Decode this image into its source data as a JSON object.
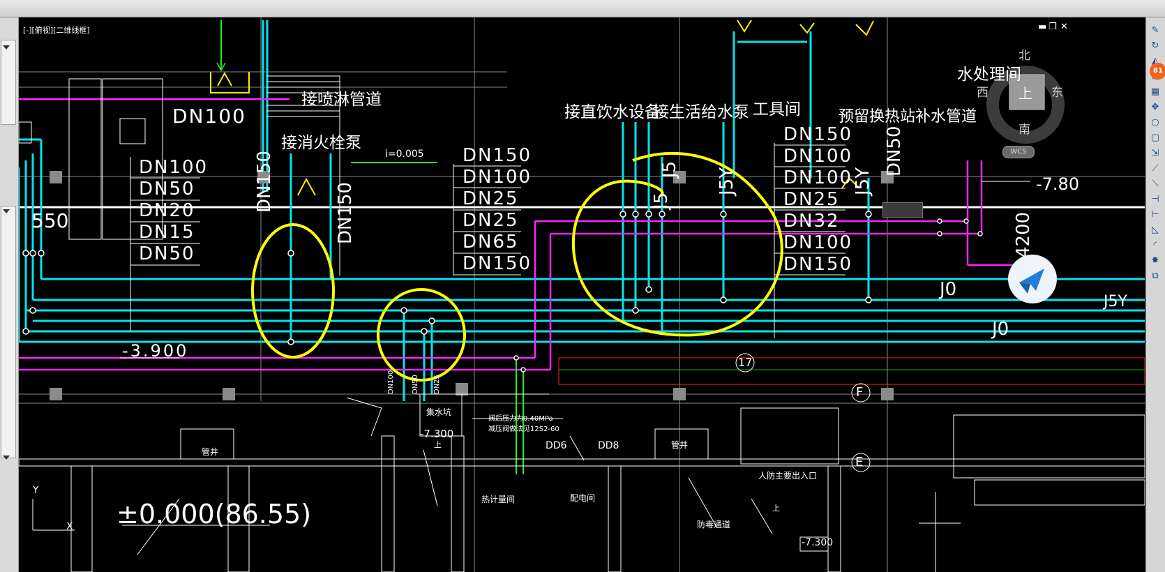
{
  "window": {
    "view_label": "[-][俯视][二维线框]",
    "min_icon": "minimize-icon",
    "restore_icon": "restore-icon",
    "close_icon": "close-icon"
  },
  "viewcube": {
    "north": "北",
    "south": "南",
    "east": "东",
    "west": "西",
    "top": "上",
    "wcs": "WCS"
  },
  "badge": "81",
  "labels": {
    "spray": "接喷淋管道",
    "hydrant": "接消火栓泵",
    "drinking": "接直饮水设备",
    "domestic": "接生活给水泵",
    "tool_room": "工具间",
    "water_room": "水处理间",
    "heat_station": "预留换热站补水管道",
    "slope": "i=0.005",
    "elev_neg39": "-3.900",
    "elev_pos0": "±0.000(86.55)",
    "elev_neg73": "-7.300",
    "elev_neg73b": "-7.300",
    "elev_780": "-7.80",
    "num_4200": "4200",
    "sump": "集水坑",
    "valve1": "阀后压力为0.40MPa",
    "valve2": "减压阀做法见12S2-60",
    "shaft1": "管井",
    "shaft2": "管井",
    "heat_meter": "热计量间",
    "dist_room": "配电间",
    "civil_entry": "人防主要出入口",
    "gas_pass": "防毒通道",
    "dd6": "DD6",
    "dd8": "DD8",
    "axis17": "17",
    "axisF": "F",
    "axisE": "E",
    "up1": "上",
    "up2": "上",
    "y_axis": "Y",
    "x_axis": "X",
    "dn100_top": "DN100",
    "dn550": "550",
    "list_left": [
      "DN100",
      "DN50",
      "DN20",
      "DN15",
      "DN50"
    ],
    "list_mid": [
      "DN150",
      "DN100",
      "DN25",
      "DN25",
      "DN65",
      "DN150"
    ],
    "list_right": [
      "DN150",
      "DN100",
      "DN100",
      "DN25",
      "DN32",
      "DN100",
      "DN150"
    ],
    "vert_dn150a": "DN150",
    "vert_dn150b": "DN150",
    "vert_j5": "J5",
    "vert_j5y": "J5Y",
    "vert_j5y2": "J5Y",
    "vert_dn50": "DN50",
    "vert_j5a": "J5",
    "small_v1": "DN100",
    "small_v2": "DN50",
    "small_v3": "DN25",
    "j0a": "J0",
    "j0b": "J0",
    "j5y_r": "J5Y"
  }
}
